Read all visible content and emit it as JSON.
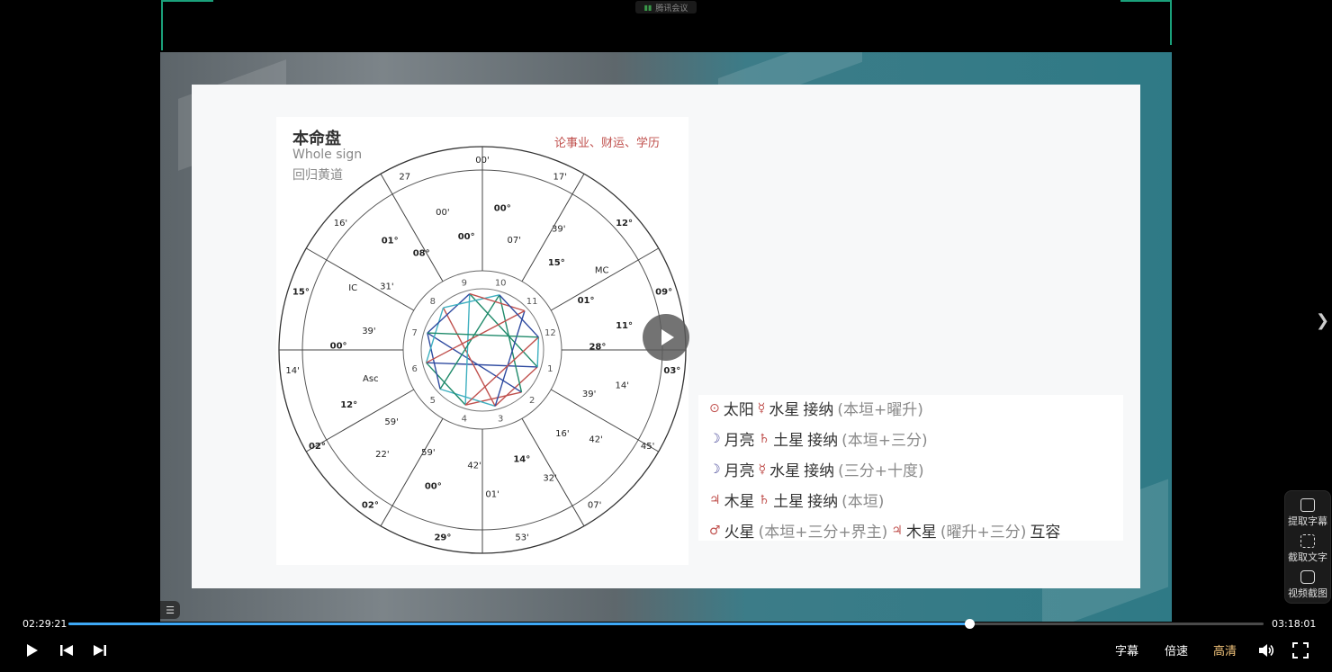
{
  "top_badge": "腾讯会议",
  "slide": {
    "chart_title": "本命盘",
    "chart_subtitle_1": "Whole sign",
    "chart_subtitle_2": "回归黄道",
    "chart_topic": "论事业、财运、学历",
    "house_numbers": [
      "1",
      "2",
      "3",
      "4",
      "5",
      "6",
      "7",
      "8",
      "9",
      "10",
      "11",
      "12"
    ],
    "chart_labels": [
      "00'",
      "00°",
      "07'",
      "17'",
      "39'",
      "15°",
      "12°",
      "MC",
      "01°",
      "09°",
      "11°",
      "28°",
      "03°",
      "14'",
      "39'",
      "45'",
      "42'",
      "16'",
      "07'",
      "32'",
      "14°",
      "53'",
      "01'",
      "42'",
      "29°",
      "00°",
      "59'",
      "02°",
      "22'",
      "59'",
      "02°",
      "12°",
      "Asc",
      "14'",
      "00°",
      "39'",
      "15°",
      "IC",
      "31'",
      "16'",
      "01°",
      "08°",
      "27",
      "00'",
      "00°"
    ],
    "relations": [
      {
        "s1": "⊙",
        "a": "太阳",
        "s2": "☿",
        "b": "水星",
        "c": "接纳",
        "note": "(本垣+曜升)"
      },
      {
        "s1": "☽",
        "a": "月亮",
        "s2": "♄",
        "b": "土星",
        "c": "接纳",
        "note": "(本垣+三分)"
      },
      {
        "s1": "☽",
        "a": "月亮",
        "s2": "☿",
        "b": "水星",
        "c": "接纳",
        "note": "(三分+十度)"
      },
      {
        "s1": "♃",
        "a": "木星",
        "s2": "♄",
        "b": "土星",
        "c": "接纳",
        "note": "(本垣)"
      }
    ],
    "last_relation": {
      "s1": "♂",
      "a": "火星",
      "note1": "(本垣+三分+界主)",
      "s2": "♃",
      "b": "木星",
      "note2": "(曜升+三分)",
      "c": "互容"
    }
  },
  "player": {
    "current_time": "02:29:21",
    "total_time": "03:18:01",
    "progress": 0.754,
    "subtitle_label": "字幕",
    "speed_label": "倍速",
    "quality_label": "高清",
    "play_icon": "play-icon",
    "prev_icon": "previous-icon",
    "next_icon": "next-icon",
    "volume_icon": "volume-icon",
    "fullscreen_icon": "fullscreen-icon"
  },
  "side_tools": {
    "extract_subtitle": "提取字幕",
    "capture_text": "截取文字",
    "screenshot": "视频截图"
  },
  "colors": {
    "accent": "#3ea8f5",
    "quality": "#f0c27a",
    "chart_red": "#c0504d",
    "chart_blue": "#2e4aa0",
    "chart_green": "#1f8a6a"
  }
}
